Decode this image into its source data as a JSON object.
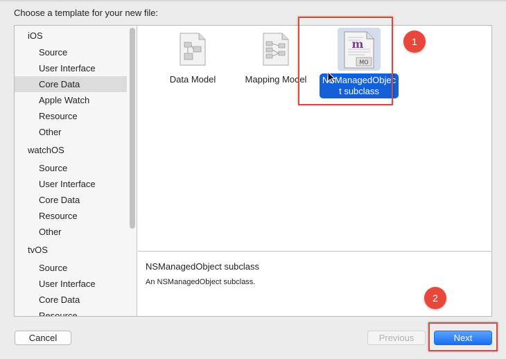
{
  "prompt": "Choose a template for your new file:",
  "sidebar": {
    "sections": [
      {
        "label": "iOS",
        "items": [
          {
            "label": "Source"
          },
          {
            "label": "User Interface"
          },
          {
            "label": "Core Data",
            "selected": true
          },
          {
            "label": "Apple Watch"
          },
          {
            "label": "Resource"
          },
          {
            "label": "Other"
          }
        ]
      },
      {
        "label": "watchOS",
        "items": [
          {
            "label": "Source"
          },
          {
            "label": "User Interface"
          },
          {
            "label": "Core Data"
          },
          {
            "label": "Resource"
          },
          {
            "label": "Other"
          }
        ]
      },
      {
        "label": "tvOS",
        "items": [
          {
            "label": "Source"
          },
          {
            "label": "User Interface"
          },
          {
            "label": "Core Data"
          },
          {
            "label": "Resource"
          }
        ]
      }
    ]
  },
  "templates": [
    {
      "label": "Data Model",
      "icon": "data-model-icon"
    },
    {
      "label": "Mapping Model",
      "icon": "mapping-model-icon"
    },
    {
      "label": "NSManagedObject subclass",
      "icon": "managed-object-icon",
      "badge": "MO",
      "glyph": "m",
      "selected": true
    }
  ],
  "description": {
    "title": "NSManagedObject subclass",
    "body": "An NSManagedObject subclass."
  },
  "buttons": {
    "cancel": "Cancel",
    "previous": "Previous",
    "next": "Next"
  },
  "annotations": {
    "step1": "1",
    "step2": "2"
  },
  "colors": {
    "selection": "#1460d8",
    "annotation": "#e8473b",
    "primary_button": "#1a6ff0"
  }
}
